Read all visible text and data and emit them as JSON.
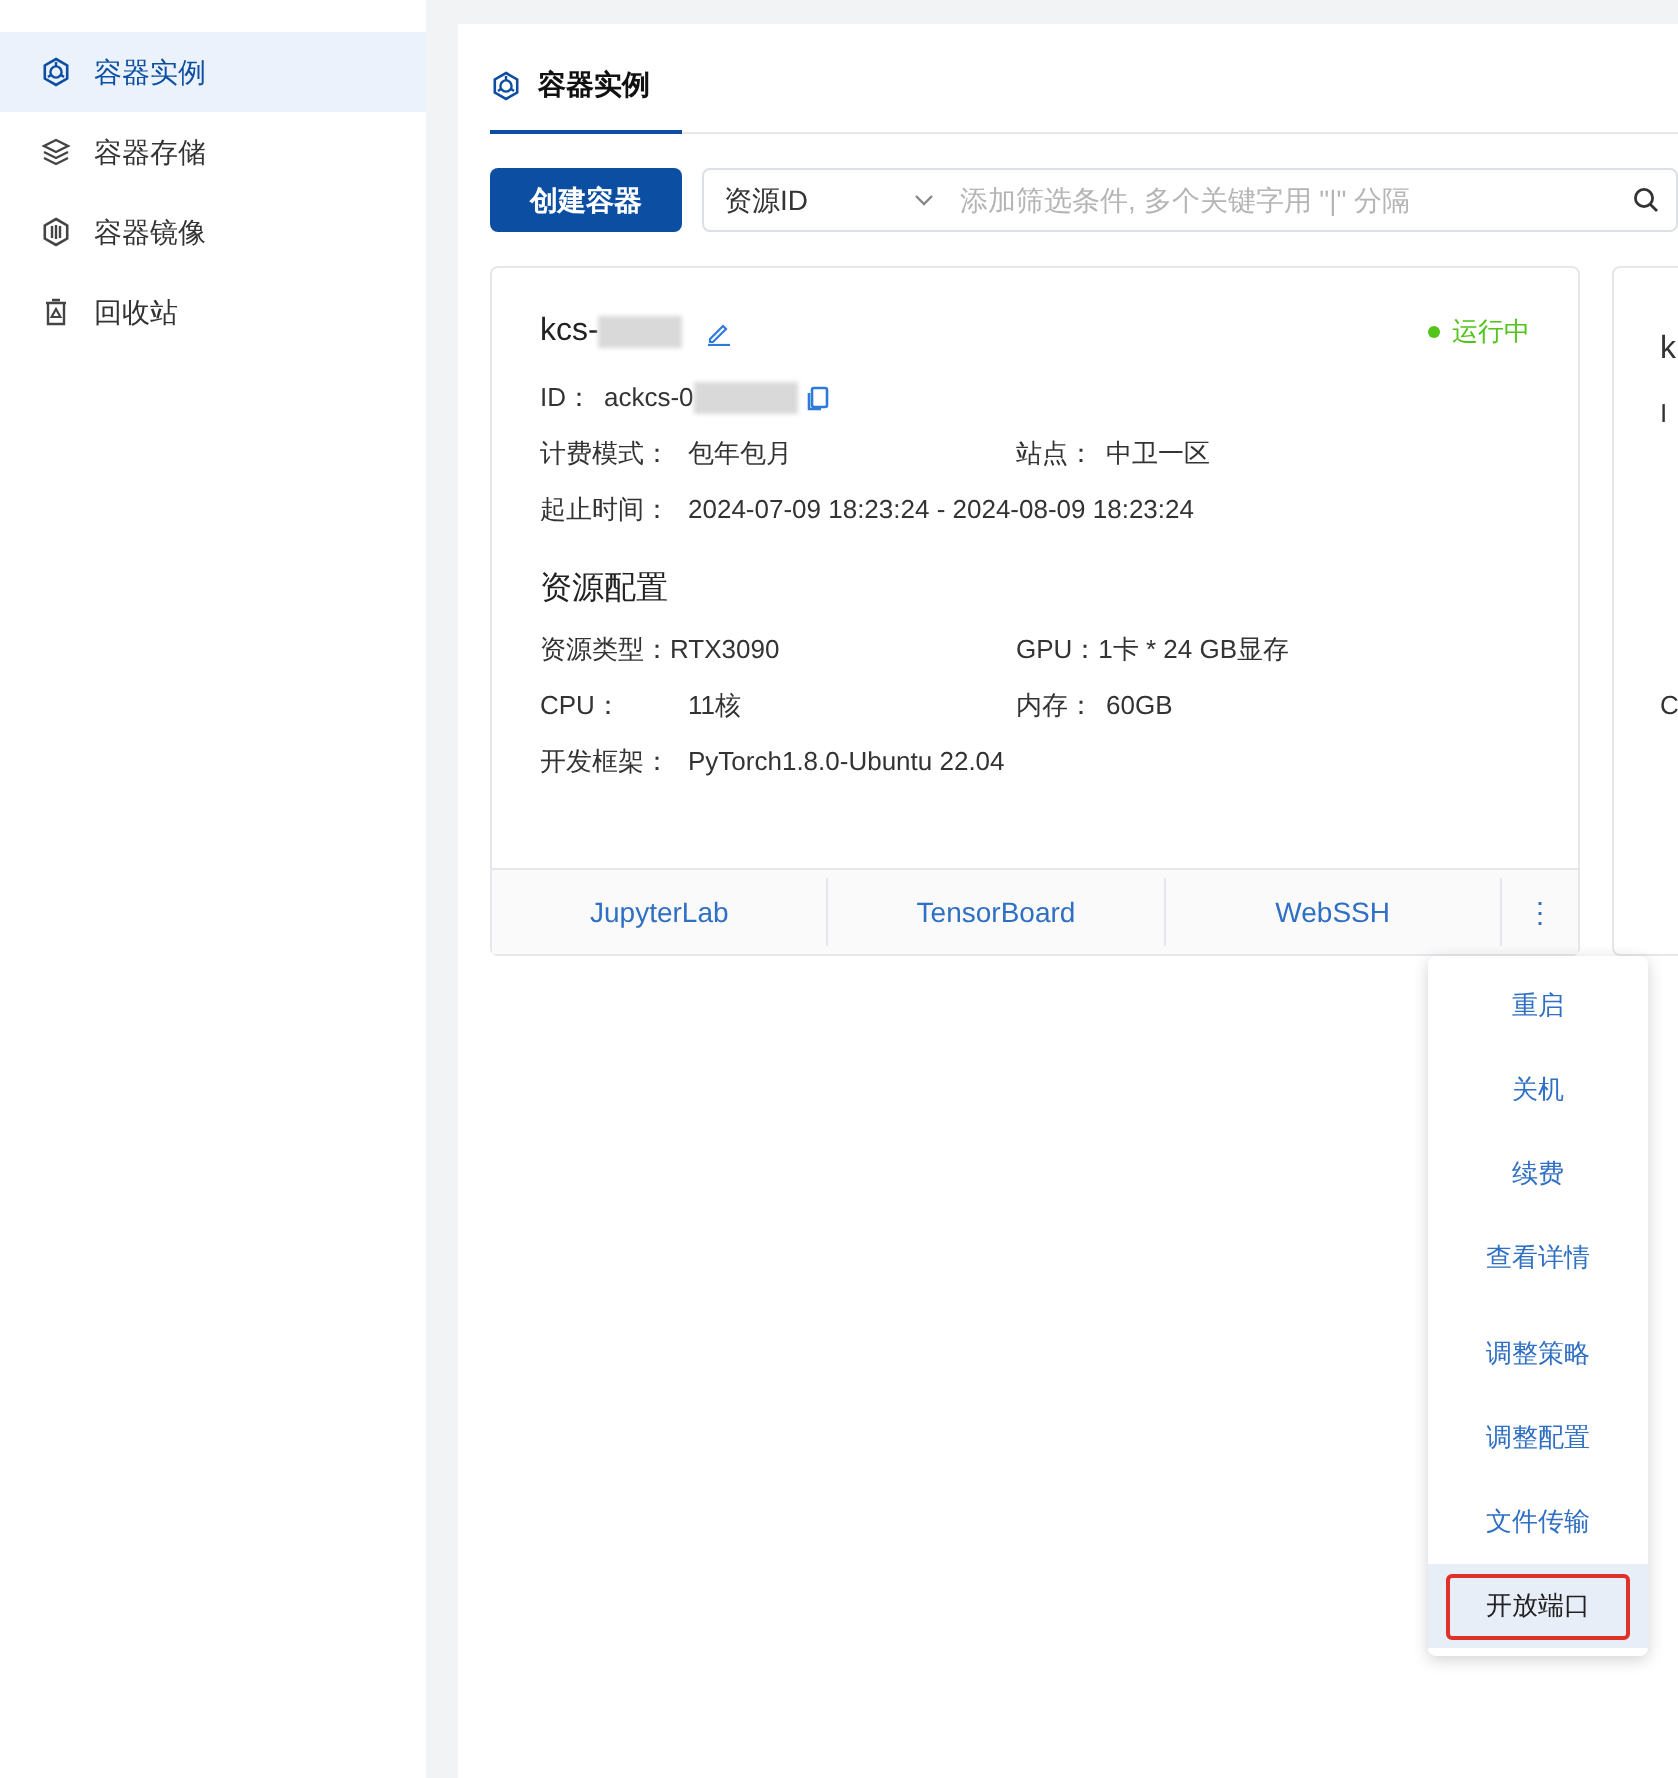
{
  "sidebar": {
    "items": [
      {
        "label": "容器实例",
        "selected": true
      },
      {
        "label": "容器存储",
        "selected": false
      },
      {
        "label": "容器镜像",
        "selected": false
      },
      {
        "label": "回收站",
        "selected": false
      }
    ]
  },
  "tabs": [
    {
      "label": "容器实例",
      "selected": true
    }
  ],
  "toolbar": {
    "create_button": "创建容器",
    "filter": {
      "field": "资源ID",
      "placeholder": "添加筛选条件, 多个关键字用 \"|\" 分隔"
    }
  },
  "cards": [
    {
      "name": "kcs-",
      "status": "运行中",
      "id_label": "ID：",
      "id_value": "ackcs-0",
      "fields": [
        {
          "label": "计费模式：",
          "value": "包年包月"
        },
        {
          "label": "站点：",
          "value": "中卫一区"
        },
        {
          "label": "起止时间：",
          "value": "2024-07-09 18:23:24 - 2024-08-09 18:23:24"
        }
      ],
      "section": "资源配置",
      "config": [
        {
          "label": "资源类型：",
          "value": "RTX3090"
        },
        {
          "label": "GPU：",
          "value": "1卡 * 24 GB显存"
        },
        {
          "label": "CPU：",
          "value": "11核"
        },
        {
          "label": "内存：",
          "value": "60GB"
        },
        {
          "label": "开发框架：",
          "value": "PyTorch1.8.0-Ubuntu 22.04"
        }
      ],
      "actions": [
        "JupyterLab",
        "TensorBoard",
        "WebSSH"
      ],
      "more": "⋮"
    }
  ],
  "partial_card": {
    "lines": [
      "k",
      "I",
      "C"
    ]
  },
  "menu": {
    "items": [
      {
        "label": "重启",
        "selected": false
      },
      {
        "label": "关机",
        "selected": false
      },
      {
        "label": "续费",
        "selected": false
      },
      {
        "label": "查看详情",
        "selected": false
      },
      {
        "label": "调整策略",
        "selected": false
      },
      {
        "label": "调整配置",
        "selected": false
      },
      {
        "label": "文件传输",
        "selected": false
      },
      {
        "label": "开放端口",
        "selected": true
      }
    ]
  }
}
